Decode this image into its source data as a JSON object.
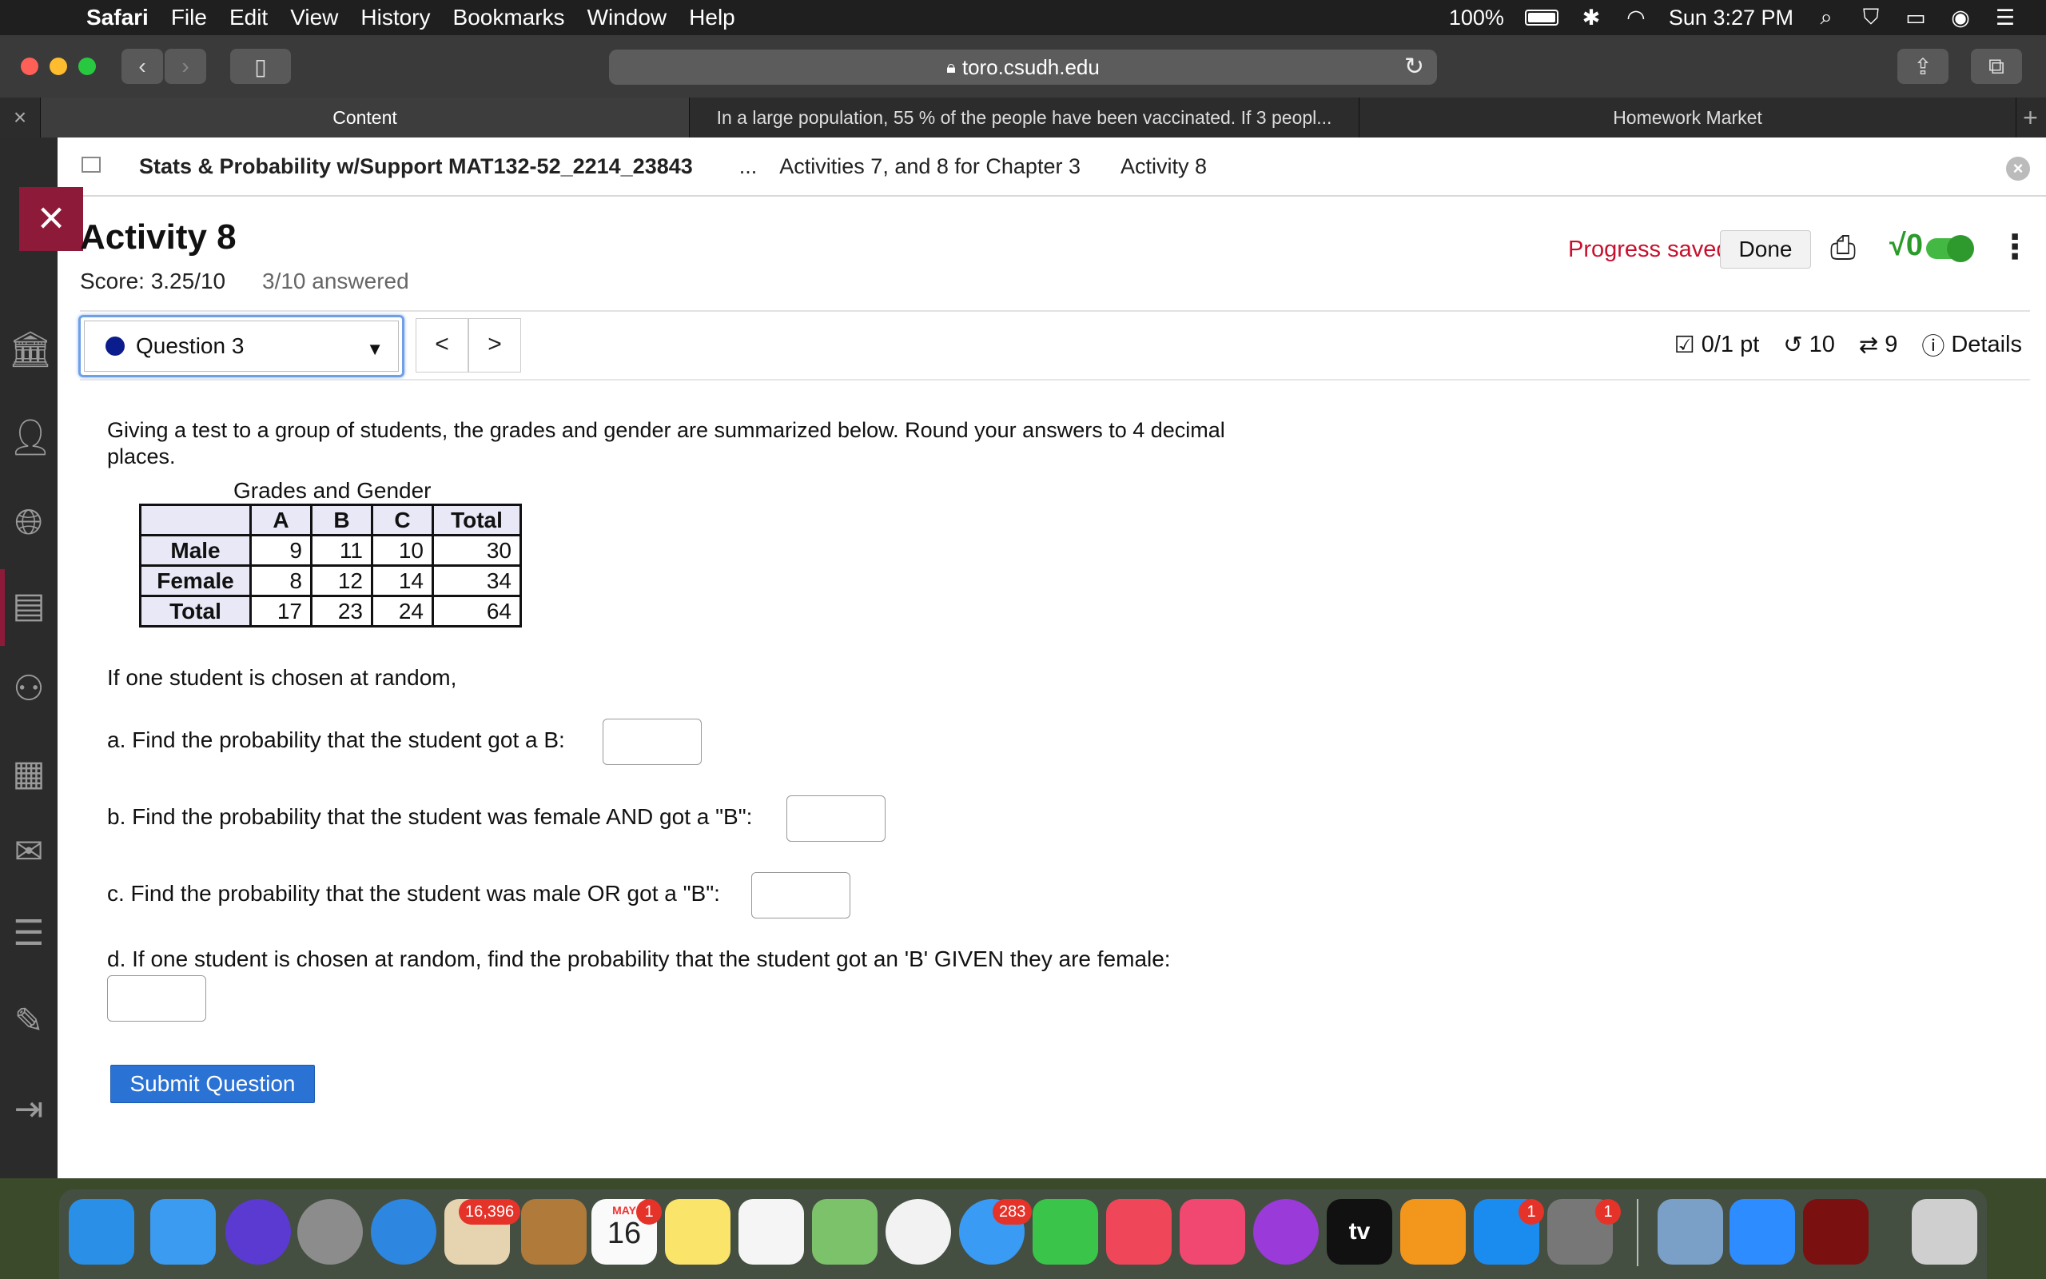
{
  "menubar": {
    "app": "Safari",
    "items": [
      "File",
      "Edit",
      "View",
      "History",
      "Bookmarks",
      "Window",
      "Help"
    ],
    "battery": "100%",
    "clock": "Sun 3:27 PM",
    "icons": [
      "apple-icon",
      "battery-icon",
      "bluetooth-icon",
      "wifi-icon",
      "spotlight-icon",
      "shield-icon",
      "airplay-icon",
      "siri-icon",
      "control-list-icon"
    ]
  },
  "browser": {
    "url": "toro.csudh.edu",
    "tabs": [
      {
        "label": "Content",
        "active": true
      },
      {
        "label": "In a large population, 55 % of the people have been vaccinated. If 3 peopl...",
        "active": false
      },
      {
        "label": "Homework Market",
        "active": false
      }
    ]
  },
  "breadcrumb": {
    "course": "Stats & Probability w/Support MAT132-52_2214_23843",
    "ellipsis": "...",
    "crumbs": [
      "Activities 7, and 8 for Chapter 3",
      "Activity 8"
    ]
  },
  "activity": {
    "title": "Activity 8",
    "score": "Score: 3.25/10",
    "answered": "3/10 answered",
    "progress": "Progress saved",
    "done": "Done",
    "sqrt": "√0"
  },
  "question": {
    "selector": "Question 3",
    "prev": "<",
    "next": ">",
    "points": "0/1 pt",
    "retries": "10",
    "attempts": "9",
    "details": "Details",
    "prompt": "Giving a test to a group of students, the grades and gender are summarized below. Round your answers to 4 decimal places.",
    "table": {
      "caption": "Grades and Gender",
      "columns": [
        "A",
        "B",
        "C",
        "Total"
      ],
      "rows": [
        {
          "label": "Male",
          "values": [
            "9",
            "11",
            "10",
            "30"
          ]
        },
        {
          "label": "Female",
          "values": [
            "8",
            "12",
            "14",
            "34"
          ]
        },
        {
          "label": "Total",
          "values": [
            "17",
            "23",
            "24",
            "64"
          ]
        }
      ]
    },
    "intro": "If one student is chosen at random,",
    "parts": {
      "a": "a.  Find the probability that the student got a B:",
      "b": "b.  Find the probability that the student was female AND got a \"B\":",
      "c": "c.  Find the probability that the student was male OR got a \"B\":",
      "d": "d.  If one student is chosen at random, find the probability that the student got an 'B' GIVEN they are female:"
    },
    "submit": "Submit Question"
  },
  "dock": {
    "badges": {
      "photos_app": "16,396",
      "calendar": "1",
      "messages": "283",
      "appstore": "1",
      "settings": "1"
    },
    "calendar_month": "MAY",
    "calendar_day": "16",
    "tv_label": "tv"
  }
}
